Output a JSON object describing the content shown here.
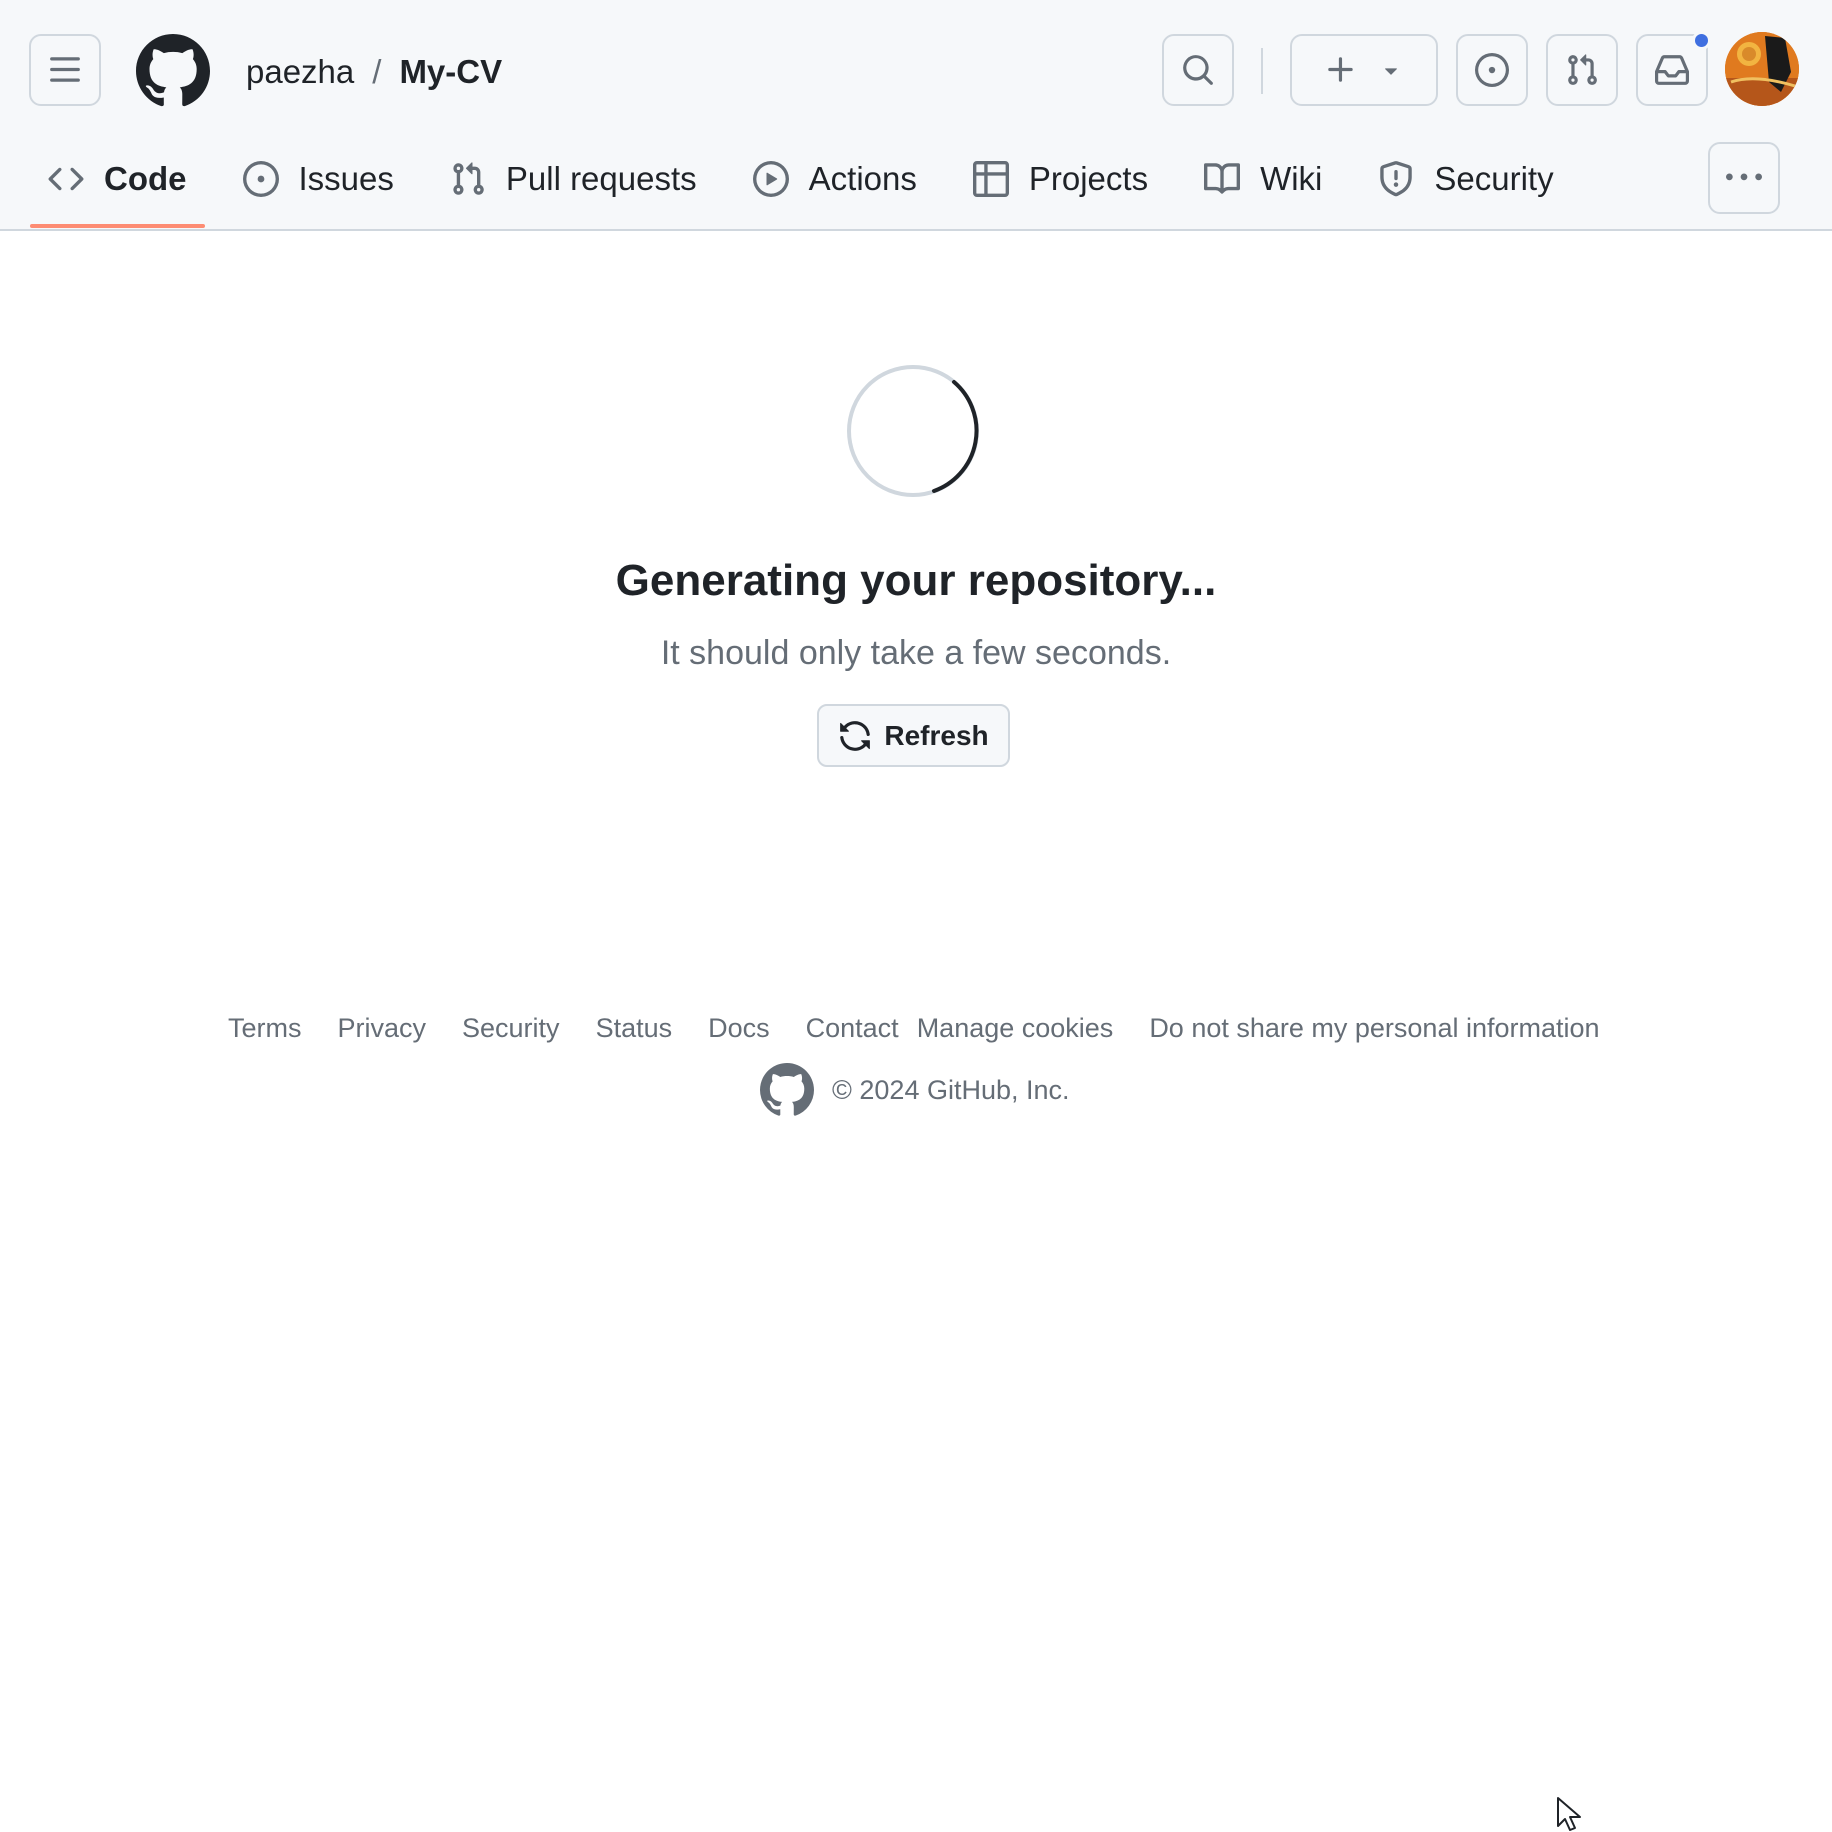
{
  "header": {
    "owner": "paezha",
    "separator": "/",
    "repo": "My-CV"
  },
  "tabs": [
    {
      "label": "Code",
      "icon": "code-icon",
      "selected": true
    },
    {
      "label": "Issues",
      "icon": "issue-opened-icon"
    },
    {
      "label": "Pull requests",
      "icon": "git-pull-request-icon"
    },
    {
      "label": "Actions",
      "icon": "play-icon"
    },
    {
      "label": "Projects",
      "icon": "table-icon"
    },
    {
      "label": "Wiki",
      "icon": "book-icon"
    },
    {
      "label": "Security",
      "icon": "shield-icon"
    }
  ],
  "main": {
    "title": "Generating your repository...",
    "subtitle": "It should only take a few seconds.",
    "refresh_label": "Refresh"
  },
  "footer": {
    "links": [
      "Terms",
      "Privacy",
      "Security",
      "Status",
      "Docs",
      "Contact",
      "Manage cookies",
      "Do not share my personal information"
    ],
    "copyright": "© 2024 GitHub, Inc."
  },
  "colors": {
    "header_bg": "#f6f8fa",
    "border": "#d0d7de",
    "text": "#1f2328",
    "muted": "#656d76",
    "selected_tab_underline": "#fd8c73",
    "notification_dot": "#3f6fe0"
  }
}
